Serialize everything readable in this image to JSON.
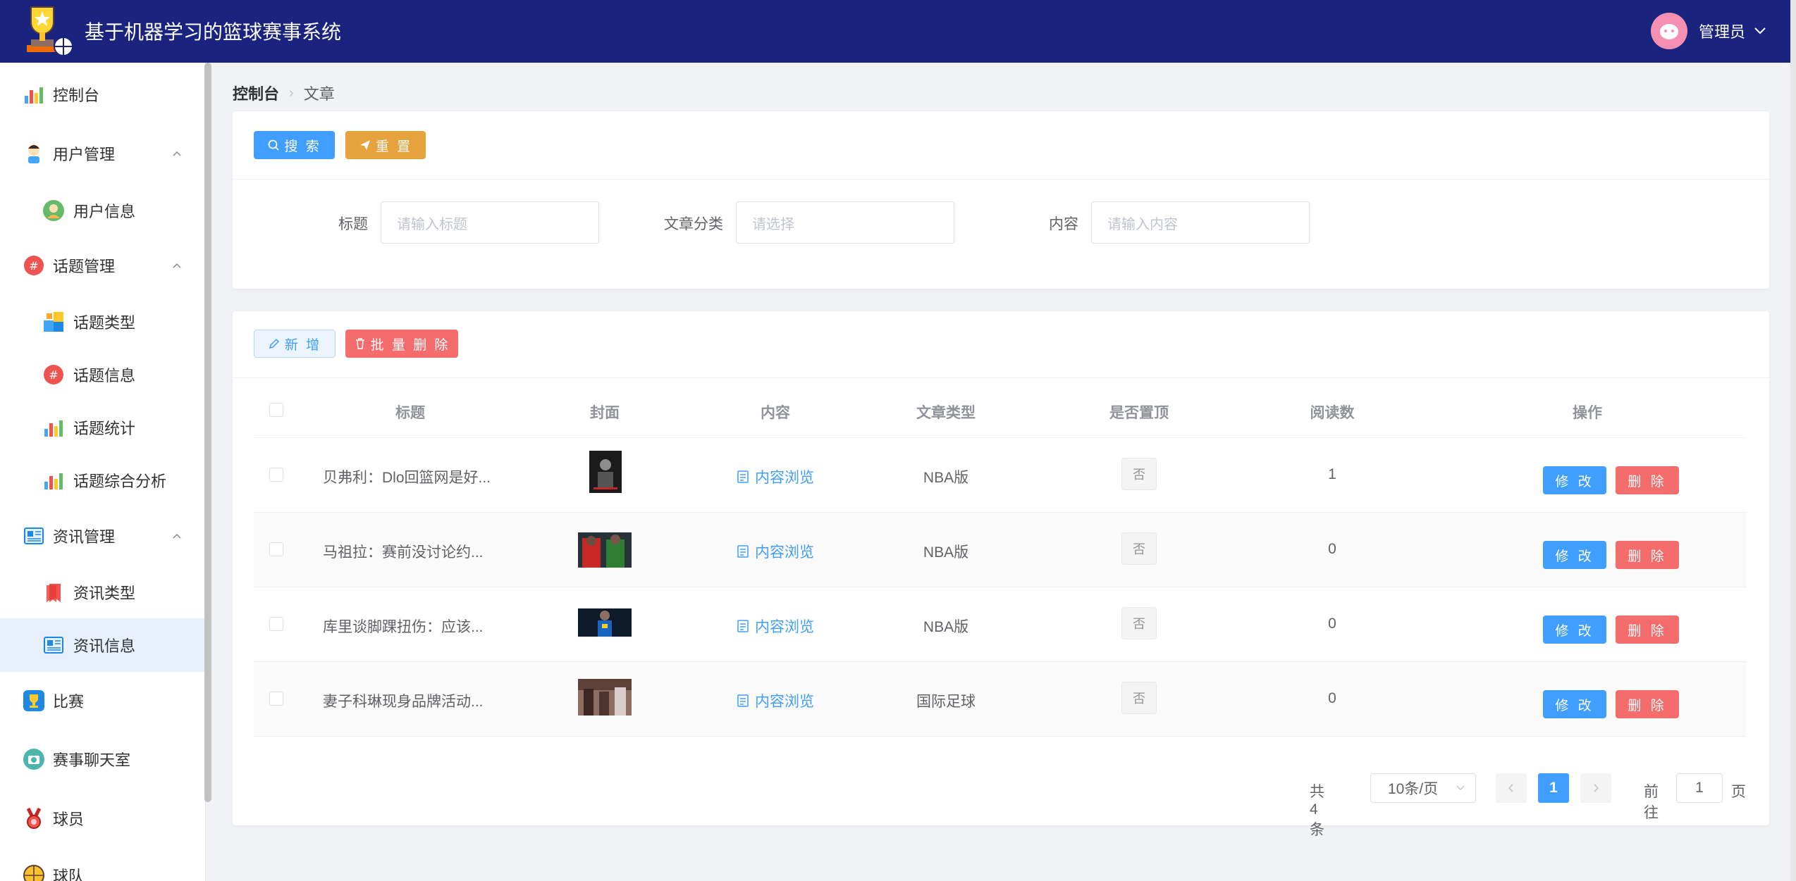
{
  "header": {
    "app_title": "基于机器学习的篮球赛事系统",
    "user_name": "管理员"
  },
  "sidebar": {
    "items": [
      {
        "label": "控制台",
        "icon": "chart-bar-icon"
      },
      {
        "label": "用户管理",
        "icon": "user-icon",
        "expanded": true
      },
      {
        "label": "用户信息",
        "icon": "user-avatar-icon"
      },
      {
        "label": "话题管理",
        "icon": "hashtag-icon",
        "expanded": true
      },
      {
        "label": "话题类型",
        "icon": "blocks-icon"
      },
      {
        "label": "话题信息",
        "icon": "hashtag-icon"
      },
      {
        "label": "话题统计",
        "icon": "chart-bar-icon"
      },
      {
        "label": "话题综合分析",
        "icon": "chart-bar-icon"
      },
      {
        "label": "资讯管理",
        "icon": "newspaper-icon",
        "expanded": true
      },
      {
        "label": "资讯类型",
        "icon": "bookmark-icon"
      },
      {
        "label": "资讯信息",
        "icon": "newspaper-icon",
        "active": true
      },
      {
        "label": "比赛",
        "icon": "trophy-icon"
      },
      {
        "label": "赛事聊天室",
        "icon": "camera-icon"
      },
      {
        "label": "球员",
        "icon": "medal-icon"
      },
      {
        "label": "球队",
        "icon": "basketball-icon"
      }
    ]
  },
  "breadcrumb": {
    "home": "控制台",
    "current": "文章"
  },
  "search": {
    "search_label": "搜 索",
    "reset_label": "重 置",
    "fields": [
      {
        "label": "标题",
        "placeholder": "请输入标题"
      },
      {
        "label": "文章分类",
        "placeholder": "请选择"
      },
      {
        "label": "内容",
        "placeholder": "请输入内容"
      }
    ]
  },
  "actions": {
    "add_label": "新 增",
    "batch_delete_label": "批 量 删 除"
  },
  "table": {
    "columns": [
      "标题",
      "封面",
      "内容",
      "文章类型",
      "是否置顶",
      "阅读数",
      "操作"
    ],
    "rows": [
      {
        "title": "贝弗利：Dlo回篮网是好...",
        "content_link": "内容浏览",
        "type": "NBA版",
        "pinned": "否",
        "reads": "1",
        "edit": "修 改",
        "delete": "删 除"
      },
      {
        "title": "马祖拉：赛前没讨论约...",
        "content_link": "内容浏览",
        "type": "NBA版",
        "pinned": "否",
        "reads": "0",
        "edit": "修 改",
        "delete": "删 除"
      },
      {
        "title": "库里谈脚踝扭伤：应该...",
        "content_link": "内容浏览",
        "type": "NBA版",
        "pinned": "否",
        "reads": "0",
        "edit": "修 改",
        "delete": "删 除"
      },
      {
        "title": "妻子科琳现身品牌活动...",
        "content_link": "内容浏览",
        "type": "国际足球",
        "pinned": "否",
        "reads": "0",
        "edit": "修 改",
        "delete": "删 除"
      }
    ]
  },
  "pagination": {
    "total": "共 4 条",
    "page_size": "10条/页",
    "current_page": "1",
    "goto_prefix": "前往",
    "goto_value": "1",
    "goto_suffix": "页"
  },
  "colors": {
    "header_bg": "#1a237e",
    "primary": "#409eff",
    "warning": "#e6a23c",
    "danger": "#f56c6c"
  }
}
